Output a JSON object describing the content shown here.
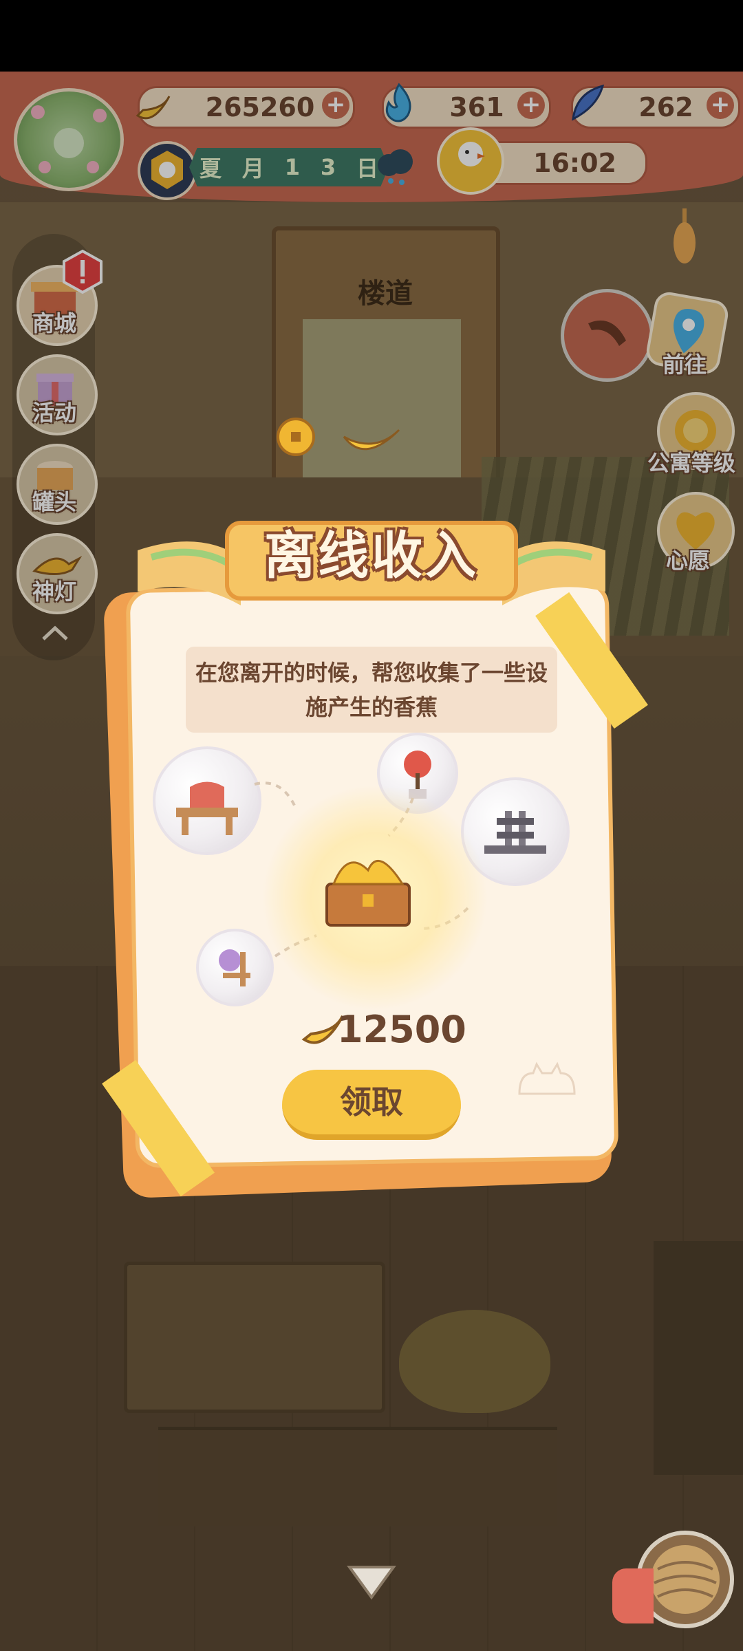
{
  "resources": {
    "banana": "265260",
    "fire": "361",
    "feather": "262"
  },
  "date": {
    "season": "夏",
    "month": "月",
    "digit1": "1",
    "digit2": "3",
    "day": "日"
  },
  "clock": "16:02",
  "location": "楼道",
  "left_menu": {
    "shop": "商城",
    "activity": "活动",
    "can": "罐头",
    "lamp": "神灯"
  },
  "right_menu": {
    "goto": "前往",
    "level": "公寓等级",
    "wish": "心愿"
  },
  "dialog": {
    "title": "离线收入",
    "message": "在您离开的时候，帮您收集了一些设施产生的香蕉",
    "amount": "12500",
    "claim": "领取"
  },
  "colors": {
    "hud": "#c96a52",
    "button": "#f7c543",
    "dialog": "#fdf3e5"
  }
}
